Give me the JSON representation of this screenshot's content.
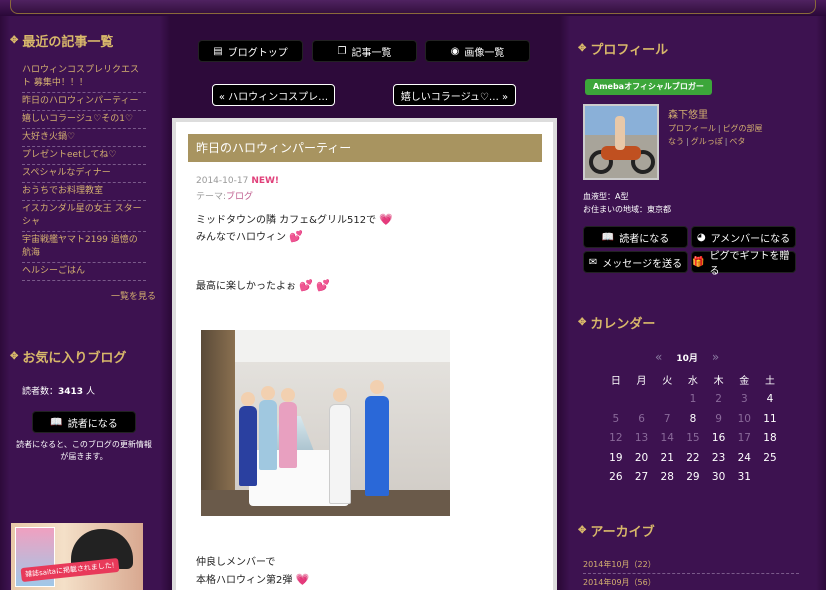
{
  "left": {
    "recent_title": "最近の記事一覧",
    "recent_posts": [
      "ハロウィンコスプレリクエスト 募集中！！！",
      "昨日のハロウィンパーティー",
      "嬉しいコラージュ♡その1♡",
      "大好き火鍋♡",
      "プレゼントeetしてね♡",
      "スペシャルなディナー",
      "おうちでお料理教室",
      "イスカンダル星の女王 スターシャ",
      "宇宙戦艦ヤマト2199 追憶の 航海",
      "ヘルシーごはん"
    ],
    "more_link": "一覧を見る",
    "fav_title": "お気に入りブログ",
    "readers_label": "読者数：",
    "readers_count": "3413",
    "readers_unit": "人",
    "reader_button": "読者になる",
    "reader_note": "読者になると、このブログの更新情報が届きます。",
    "ad_text": "雑誌saitaに掲載されました!"
  },
  "nav": {
    "blog_top": "ブログトップ",
    "post_list": "記事一覧",
    "image_list": "画像一覧",
    "prev": "« ハロウィンコスプレ…",
    "next": "嬉しいコラージュ♡… »"
  },
  "article": {
    "title": "昨日のハロウィンパーティー",
    "date": "2014-10-17",
    "new_badge": "NEW!",
    "theme_label": "テーマ:",
    "theme": "ブログ",
    "line1": "ミッドタウンの隣 カフェ&グリル512で",
    "line2": "みんなでハロウィン",
    "line3": "最高に楽しかったよぉ",
    "line4": "仲良しメンバーで",
    "line5": "本格ハロウィン第2弾"
  },
  "right": {
    "profile_title": "プロフィール",
    "official_badge": "Amebaオフィシャルブロガー",
    "name": "森下悠里",
    "link1": "プロフィール",
    "link2": "ピグの部屋",
    "link3": "なう",
    "link4": "グルっぽ",
    "link5": "ペタ",
    "blood": "血液型：A型",
    "home": "お住まいの地域：東京都",
    "btn_reader": "読者になる",
    "btn_member": "アメンバーになる",
    "btn_message": "メッセージを送る",
    "btn_gift": "ピグでギフトを贈る",
    "calendar_title": "カレンダー",
    "month": "10月",
    "weekdays": [
      "日",
      "月",
      "火",
      "水",
      "木",
      "金",
      "土"
    ],
    "archive_title": "アーカイブ",
    "archive": [
      "2014年10月（22）",
      "2014年09月（56）"
    ]
  },
  "colors": {
    "accent_gold": "#d8b86a",
    "bg_purple": "#3a0f4a",
    "title_bar": "#a89460",
    "heart_pink": "#e8508a",
    "badge_green": "#3ca63a"
  }
}
